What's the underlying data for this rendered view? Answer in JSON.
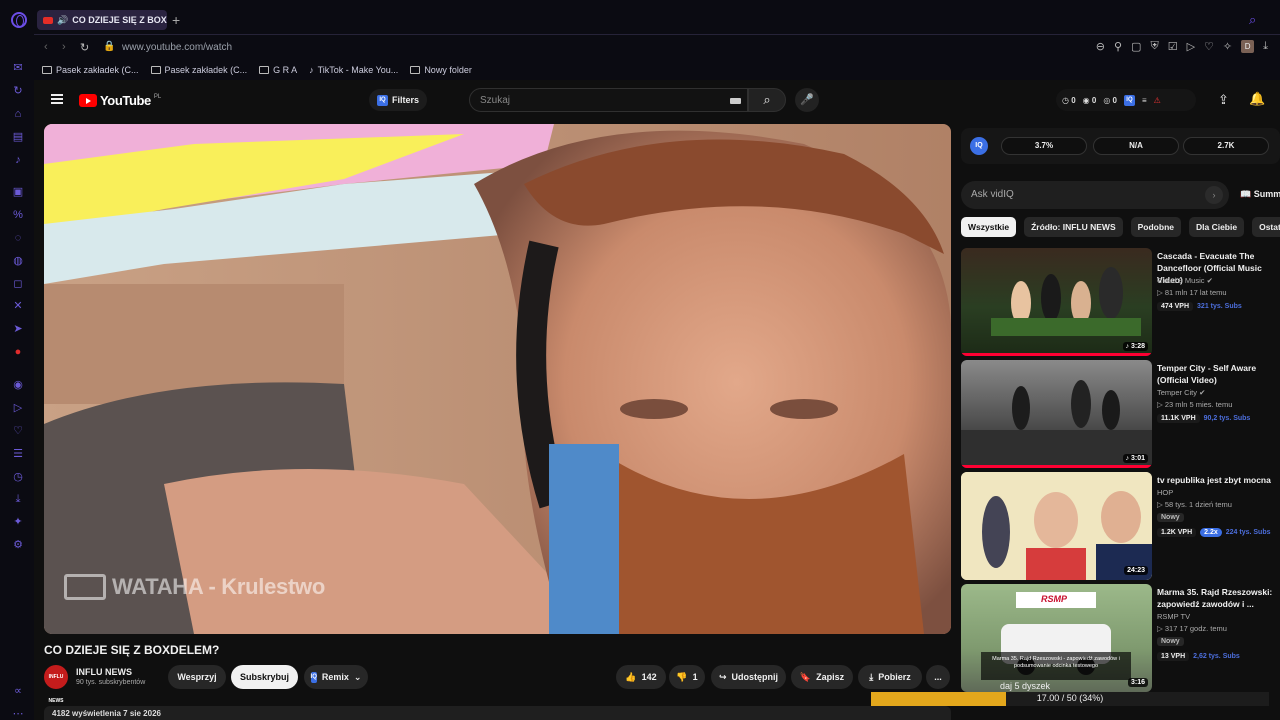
{
  "browser": {
    "tab_title": "CO DZIEJE SIĘ Z BOXDE",
    "url": "www.youtube.com/watch",
    "bookmarks": [
      "Pasek zakładek (C...",
      "Pasek zakładek (C...",
      "G R A",
      "TikTok - Make You...",
      "Nowy folder"
    ],
    "profile_letter": "D"
  },
  "yt": {
    "logo_text": "YouTube",
    "logo_region": "PL",
    "filters_label": "Filters",
    "search_placeholder": "Szukaj",
    "stats": [
      "0",
      "0",
      "0"
    ],
    "video": {
      "watermark": "WATAHA - Krulestwo",
      "title": "CO DZIEJE SIĘ Z BOXDELEM?",
      "channel": "INFLU NEWS",
      "channel_subs": "90 tys. subskrybentów",
      "avatar_text": "INFLU NEWS",
      "buttons": {
        "support": "Wesprzyj",
        "subscribe": "Subskrybuj",
        "remix": "Remix",
        "likes": "142",
        "dislikes": "1",
        "share": "Udostępnij",
        "save": "Zapisz",
        "download": "Pobierz",
        "more": "..."
      },
      "desc_line": "4182 wyświetlenia  7 sie 2026"
    },
    "vidiq": {
      "logo": "IQ",
      "pills": [
        "3.7%",
        "N/A",
        "2.7K"
      ],
      "ask_placeholder": "Ask vidIQ",
      "summary": "Summ"
    },
    "chips": [
      "Wszystkie",
      "Źródło: INFLU NEWS",
      "Podobne",
      "Dla Ciebie",
      "Ostatnio"
    ],
    "recommendations": [
      {
        "title": "Cascada - Evacuate The Dancefloor (Official Music Video)",
        "channel": "Cloud 9 Music",
        "meta": "▷ 81 mln  17 lat temu",
        "duration": "♪ 3:28",
        "vph": "474 VPH",
        "subs": "321 tys. Subs",
        "progress": 1.0
      },
      {
        "title": "Temper City - Self Aware (Official Video)",
        "channel": "Temper City",
        "meta": "▷ 23 mln  5 mies. temu",
        "duration": "♪ 3:01",
        "vph": "11.1K VPH",
        "subs": "90,2 tys. Subs",
        "progress": 1.0
      },
      {
        "title": "tv republika jest zbyt mocna",
        "channel": "HOP",
        "meta": "▷ 58 tys.  1 dzień temu",
        "duration": "24:23",
        "tag": "Nowy",
        "vph": "1.2K VPH",
        "mult": "2.2x",
        "subs": "224 tys. Subs",
        "progress": 0
      },
      {
        "title": "Marma 35. Rajd Rzeszowski: zapowiedź zawodów i ...",
        "channel": "RSMP TV",
        "meta": "▷ 317  17 godz. temu",
        "duration": "3:16",
        "tag": "Nowy",
        "vph": "13 VPH",
        "subs": "2,62 tys. Subs",
        "thumb_text": "RSMP",
        "thumb_caption": "Marma 35. Rajd Rzeszowski - zapowiedź zawodów i podsumowanie odcinka testowego",
        "progress": 0
      }
    ]
  },
  "overlay": {
    "label": "daj 5 dyszek",
    "text": "17.00 / 50 (34%)",
    "fraction": 0.34
  },
  "colors": {
    "accent": "#6c4ee8",
    "yt_red": "#ff0000",
    "vidiq_blue": "#3b6fe5",
    "overlay_fill": "#e3a71c"
  }
}
